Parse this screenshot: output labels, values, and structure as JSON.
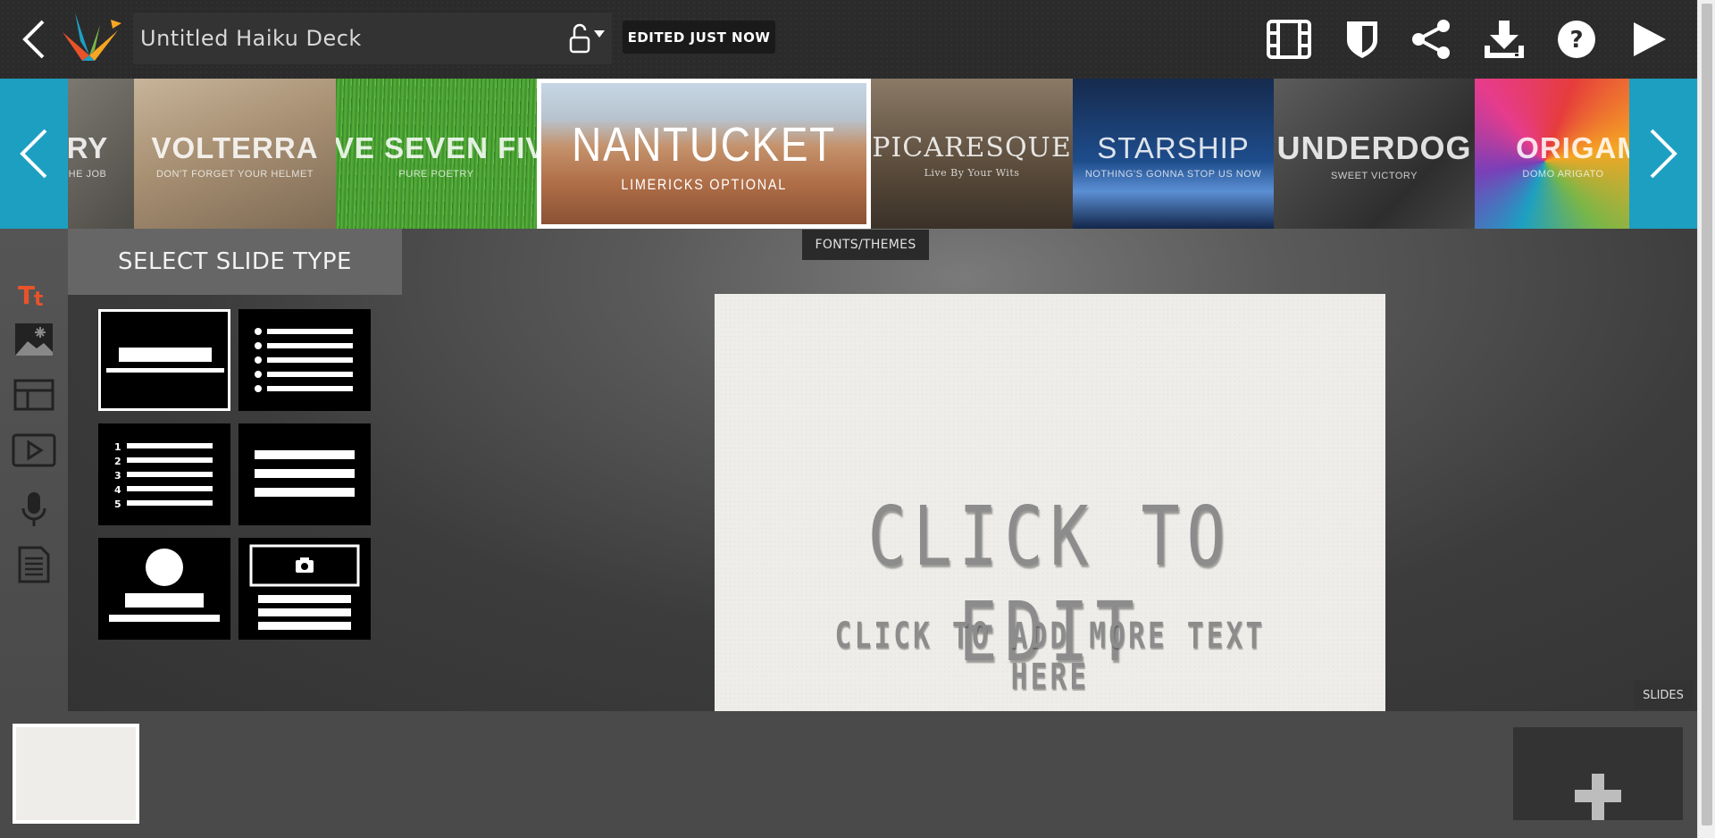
{
  "header": {
    "title": "Untitled Haiku Deck",
    "status": "EDITED JUST NOW"
  },
  "themes": [
    {
      "name": "RY",
      "subtitle": "HE JOB",
      "bg": "#6b6a63"
    },
    {
      "name": "VOLTERRA",
      "subtitle": "DON'T FORGET YOUR HELMET",
      "bg": "#a3917b"
    },
    {
      "name": "FIVE SEVEN FIVE",
      "subtitle": "PURE POETRY",
      "bg": "#3f8a2d"
    },
    {
      "name": "NANTUCKET",
      "subtitle": "LIMERICKS OPTIONAL",
      "bg": "#b8805f"
    },
    {
      "name": "PICARESQUE",
      "subtitle": "Live By Your Wits",
      "bg": "#6e5e4c"
    },
    {
      "name": "STARSHIP",
      "subtitle": "NOTHING'S GONNA STOP US NOW",
      "bg": "#1c3a6e"
    },
    {
      "name": "UNDERDOG",
      "subtitle": "SWEET VICTORY",
      "bg": "#4a4a4a"
    },
    {
      "name": "ORIGAM",
      "subtitle": "DOMO ARIGATO",
      "bg": "#8a4b7a"
    }
  ],
  "fonts_themes_label": "FONTS/THEMES",
  "panel": {
    "title": "SELECT SLIDE TYPE",
    "layouts": [
      "title",
      "bulleted-list",
      "numbered-list",
      "text-block",
      "profile",
      "photo-text"
    ],
    "numbers": [
      "1",
      "2",
      "3",
      "4",
      "5"
    ]
  },
  "slide": {
    "title": "CLICK TO EDIT",
    "subtitle": "CLICK TO ADD MORE TEXT HERE"
  },
  "slides_label": "SLIDES",
  "colors": {
    "accent": "#1d9fc2",
    "active_rail": "#e8532a"
  }
}
